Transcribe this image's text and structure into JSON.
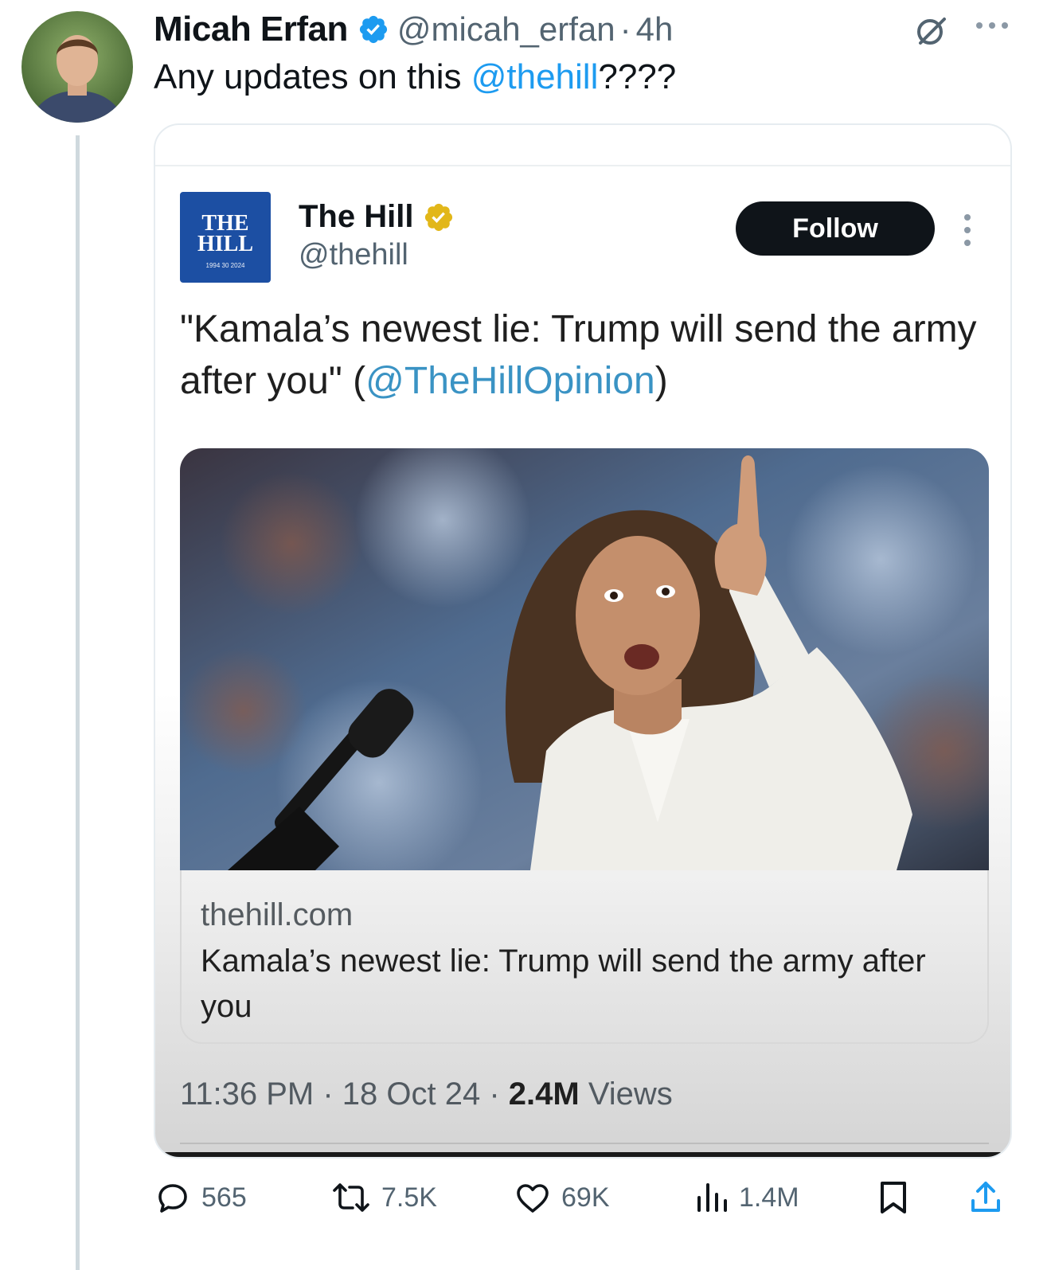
{
  "tweet": {
    "author_name": "Micah Erfan",
    "author_handle": "@micah_erfan",
    "separator": "·",
    "time": "4h",
    "text_before": "Any updates on this ",
    "mention": "@thehill",
    "text_after": "????"
  },
  "quoted": {
    "logo_line1": "THE",
    "logo_line2": "HILL",
    "logo_line3": "1994 30 2024",
    "name": "The Hill",
    "handle": "@thehill",
    "follow_label": "Follow",
    "text_before": "\"Kamala’s newest lie: Trump will send the army after you\" (",
    "mention": "@TheHillOpinion",
    "text_after": ")",
    "link_domain": "thehill.com",
    "link_title": "Kamala’s newest lie: Trump will send the army after you",
    "meta_time": "11:36 PM",
    "meta_sep": " · ",
    "meta_date": "18 Oct 24",
    "meta_sep2": " · ",
    "meta_views_count": "2.4M",
    "meta_views_label": " Views"
  },
  "actions": {
    "replies": "565",
    "reposts": "7.5K",
    "likes": "69K",
    "views": "1.4M"
  },
  "colors": {
    "accent": "#1d9bf0",
    "text": "#0f1419",
    "secondary": "#536471",
    "hill_blue": "#1c4fa3",
    "gold_badge": "#e2b719"
  },
  "icons": [
    "verified-badge-icon",
    "grok-icon",
    "more-icon",
    "gold-verified-badge-icon",
    "vertical-more-icon",
    "reply-icon",
    "repost-icon",
    "like-icon",
    "views-icon",
    "bookmark-icon",
    "share-icon"
  ]
}
